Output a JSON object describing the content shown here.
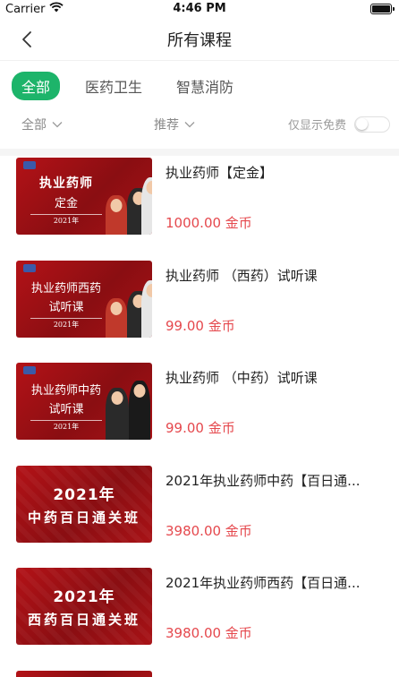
{
  "status": {
    "carrier": "Carrier",
    "time": "4:46 PM"
  },
  "header": {
    "title": "所有课程"
  },
  "tabs": [
    {
      "label": "全部",
      "active": true
    },
    {
      "label": "医药卫生",
      "active": false
    },
    {
      "label": "智慧消防",
      "active": false
    }
  ],
  "filters": {
    "all_label": "全部",
    "sort_label": "推荐",
    "free_label": "仅显示免费",
    "free_only": false
  },
  "colors": {
    "accent": "#1db46a",
    "price": "#e5484d",
    "thumb_red": "#b31217"
  },
  "courses": [
    {
      "title": "执业药师【定金】",
      "price": "1000.00 金币",
      "thumb_line1": "执业药师",
      "thumb_line2": "定金",
      "thumb_year": "2021年"
    },
    {
      "title": "执业药师 （西药）试听课",
      "price": "99.00 金币",
      "thumb_line1": "执业药师西药",
      "thumb_line2": "试听课",
      "thumb_year": "2021年"
    },
    {
      "title": "执业药师 （中药）试听课",
      "price": "99.00 金币",
      "thumb_line1": "执业药师中药",
      "thumb_line2": "试听课",
      "thumb_year": "2021年"
    },
    {
      "title": "2021年执业药师中药【百日通...",
      "price": "3980.00 金币",
      "thumb_line1": "2021年",
      "thumb_line2": "中药百日通关班"
    },
    {
      "title": "2021年执业药师西药【百日通...",
      "price": "3980.00 金币",
      "thumb_line1": "2021年",
      "thumb_line2": "西药百日通关班"
    }
  ]
}
